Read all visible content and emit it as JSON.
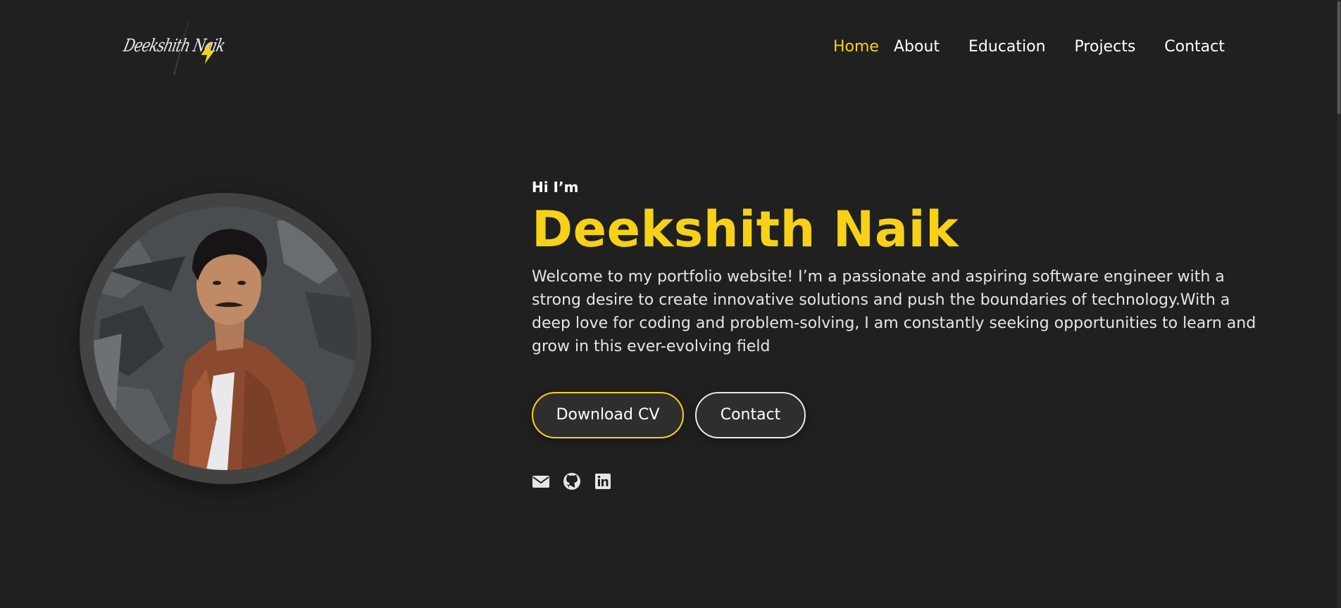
{
  "logo": {
    "text": "Deekshith Naik",
    "icon": "lightning-bolt-icon",
    "accent": "#f7d117"
  },
  "nav": {
    "items": [
      {
        "label": "Home",
        "active": true
      },
      {
        "label": "About",
        "active": false
      },
      {
        "label": "Education",
        "active": false
      },
      {
        "label": "Projects",
        "active": false
      },
      {
        "label": "Contact",
        "active": false
      }
    ]
  },
  "hero": {
    "greeting": "Hi I’m",
    "name": "Deekshith Naik",
    "intro": "Welcome to my portfolio website! I’m a passionate and aspiring software engineer with a strong desire to create innovative solutions and push the boundaries of technology.With a deep love for coding and problem-solving, I am constantly seeking opportunities to learn and grow in this ever-evolving field",
    "buttons": {
      "download_cv": "Download CV",
      "contact": "Contact"
    },
    "socials": [
      {
        "icon": "envelope-icon"
      },
      {
        "icon": "github-icon"
      },
      {
        "icon": "linkedin-icon"
      }
    ]
  },
  "colors": {
    "background": "#202020",
    "accent": "#f7d117",
    "text": "#ffffff",
    "ring": "#434343"
  }
}
